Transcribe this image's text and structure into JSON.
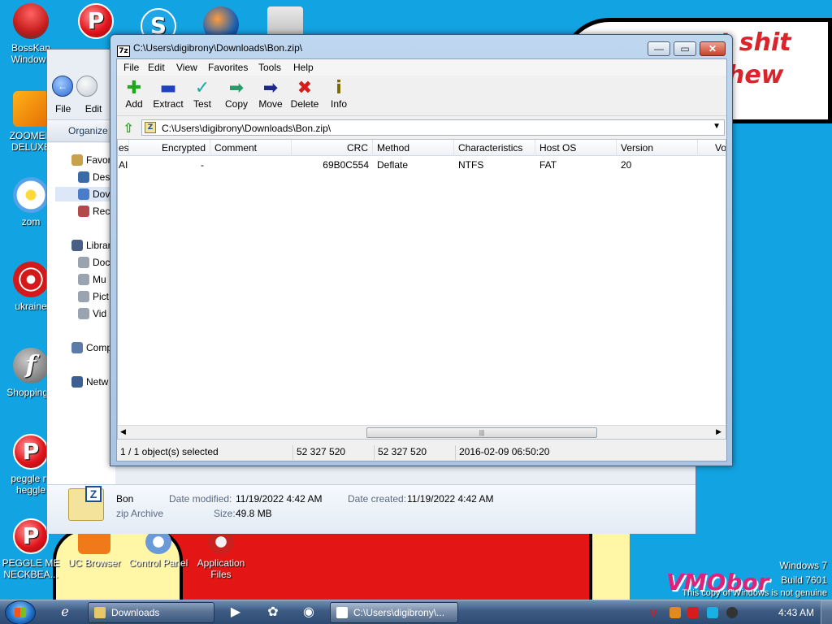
{
  "desktop": {
    "wallpaper_text": [
      "t shit",
      "hew"
    ],
    "watermark": "VMObor",
    "os_note": [
      "Windows 7",
      "Build 7601",
      "This copy of Windows is not genuine"
    ],
    "icons": [
      {
        "label": "BossKan Windows",
        "icon": "bowl-icon"
      },
      {
        "label": "ZOOMER DELUXE",
        "icon": "zoomer-icon"
      },
      {
        "label": "zom",
        "icon": "flower-icon"
      },
      {
        "label": "ukraine",
        "icon": "radiation-icon"
      },
      {
        "label": "ShoppingC",
        "icon": "flash-icon"
      },
      {
        "label": "peggle m heggle",
        "icon": "peggle-icon"
      },
      {
        "label": "PEGGLE ME NECKBEA...",
        "icon": "peggle-icon"
      },
      {
        "label": "UC Browser",
        "icon": "uc-browser-icon"
      },
      {
        "label": "Control Panel",
        "icon": "control-panel-icon"
      },
      {
        "label": "Application Files",
        "icon": "app-files-icon"
      }
    ]
  },
  "explorer": {
    "menu": [
      "File",
      "Edit"
    ],
    "organize": "Organize",
    "tree": [
      "Favor",
      "Des",
      "Dov",
      "Rec",
      "Librar",
      "Doc",
      "Mu",
      "Pict",
      "Vid",
      "Comp",
      "Netw"
    ],
    "details": {
      "name": "Bon",
      "type": "zip Archive",
      "modified_label": "Date modified:",
      "modified_value": "11/19/2022 4:42 AM",
      "created_label": "Date created:",
      "created_value": "11/19/2022 4:42 AM",
      "size_label": "Size:",
      "size_value": "49.8 MB"
    }
  },
  "zip_window": {
    "title": "C:\\Users\\digibrony\\Downloads\\Bon.zip\\",
    "logo": "7z",
    "menu": [
      "File",
      "Edit",
      "View",
      "Favorites",
      "Tools",
      "Help"
    ],
    "toolbar": [
      {
        "label": "Add",
        "icon": "add-icon",
        "glyph": "✚",
        "color": "#1fa81b"
      },
      {
        "label": "Extract",
        "icon": "extract-icon",
        "glyph": "▬",
        "color": "#2040c0"
      },
      {
        "label": "Test",
        "icon": "test-icon",
        "glyph": "✓",
        "color": "#18a8a8"
      },
      {
        "label": "Copy",
        "icon": "copy-icon",
        "glyph": "➡",
        "color": "#2b9a6b"
      },
      {
        "label": "Move",
        "icon": "move-icon",
        "glyph": "➡",
        "color": "#1d2a8a"
      },
      {
        "label": "Delete",
        "icon": "delete-icon",
        "glyph": "✖",
        "color": "#d81b1b"
      },
      {
        "label": "Info",
        "icon": "info-icon",
        "glyph": "i",
        "color": "#7a6a00"
      }
    ],
    "address": "C:\\Users\\digibrony\\Downloads\\Bon.zip\\",
    "columns": [
      "es",
      "Encrypted",
      "Comment",
      "CRC",
      "Method",
      "Characteristics",
      "Host OS",
      "Version",
      "Vo"
    ],
    "rows": [
      {
        "c0": "AI",
        "encrypted": "-",
        "comment": "",
        "crc": "69B0C554",
        "method": "Deflate",
        "characteristics": "NTFS",
        "host_os": "FAT",
        "version": "20",
        "vo": ""
      }
    ],
    "status": {
      "selected": "1 / 1 object(s) selected",
      "size": "52 327 520",
      "packed": "52 327 520",
      "date": "2016-02-09 06:50:20"
    }
  },
  "taskbar": {
    "buttons": [
      {
        "label": "Downloads",
        "active": false
      },
      {
        "label": "C:\\Users\\digibrony\\...",
        "active": true
      }
    ],
    "clock": "4:43 AM"
  }
}
